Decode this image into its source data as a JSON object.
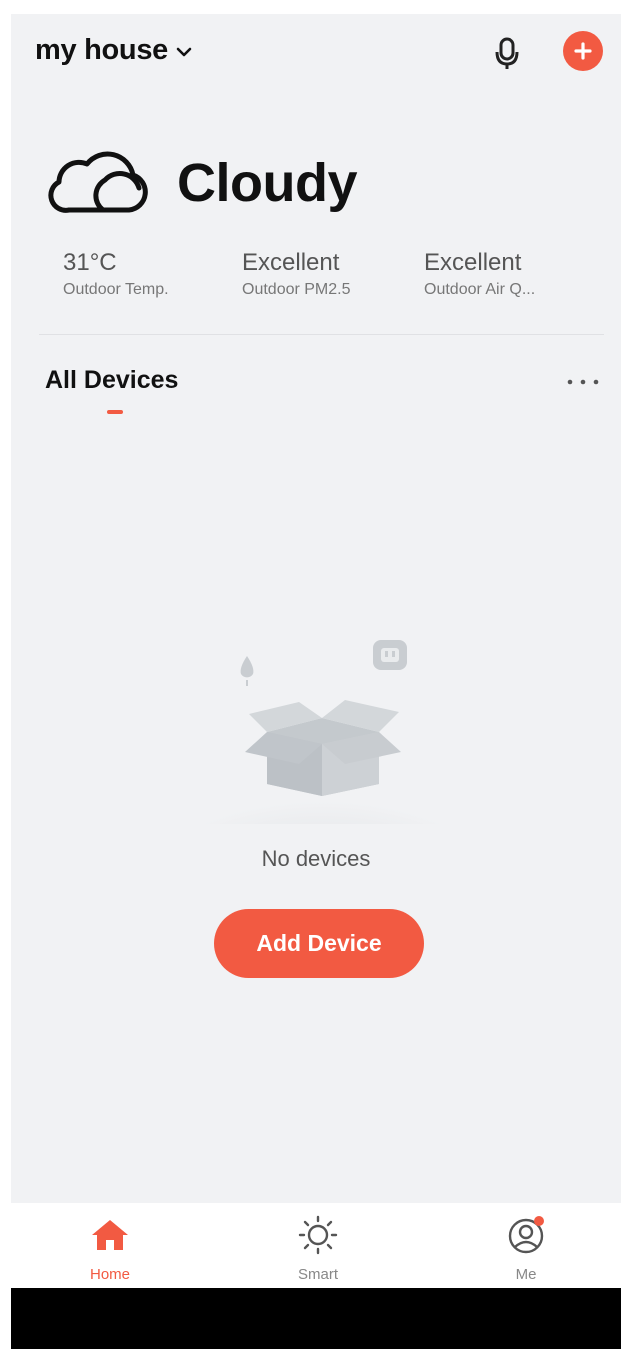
{
  "header": {
    "home_name": "my house"
  },
  "weather": {
    "condition": "Cloudy",
    "stats": [
      {
        "value": "31°C",
        "label": "Outdoor Temp."
      },
      {
        "value": "Excellent",
        "label": "Outdoor PM2.5"
      },
      {
        "value": "Excellent",
        "label": "Outdoor Air Q..."
      }
    ]
  },
  "tabs": {
    "all_devices": "All Devices"
  },
  "empty_state": {
    "message": "No devices",
    "button_label": "Add Device"
  },
  "bottom_nav": [
    {
      "label": "Home",
      "icon": "home-icon",
      "active": true
    },
    {
      "label": "Smart",
      "icon": "sun-icon",
      "active": false
    },
    {
      "label": "Me",
      "icon": "profile-icon",
      "active": false
    }
  ],
  "colors": {
    "accent": "#f25a42",
    "background": "#f1f2f4"
  }
}
